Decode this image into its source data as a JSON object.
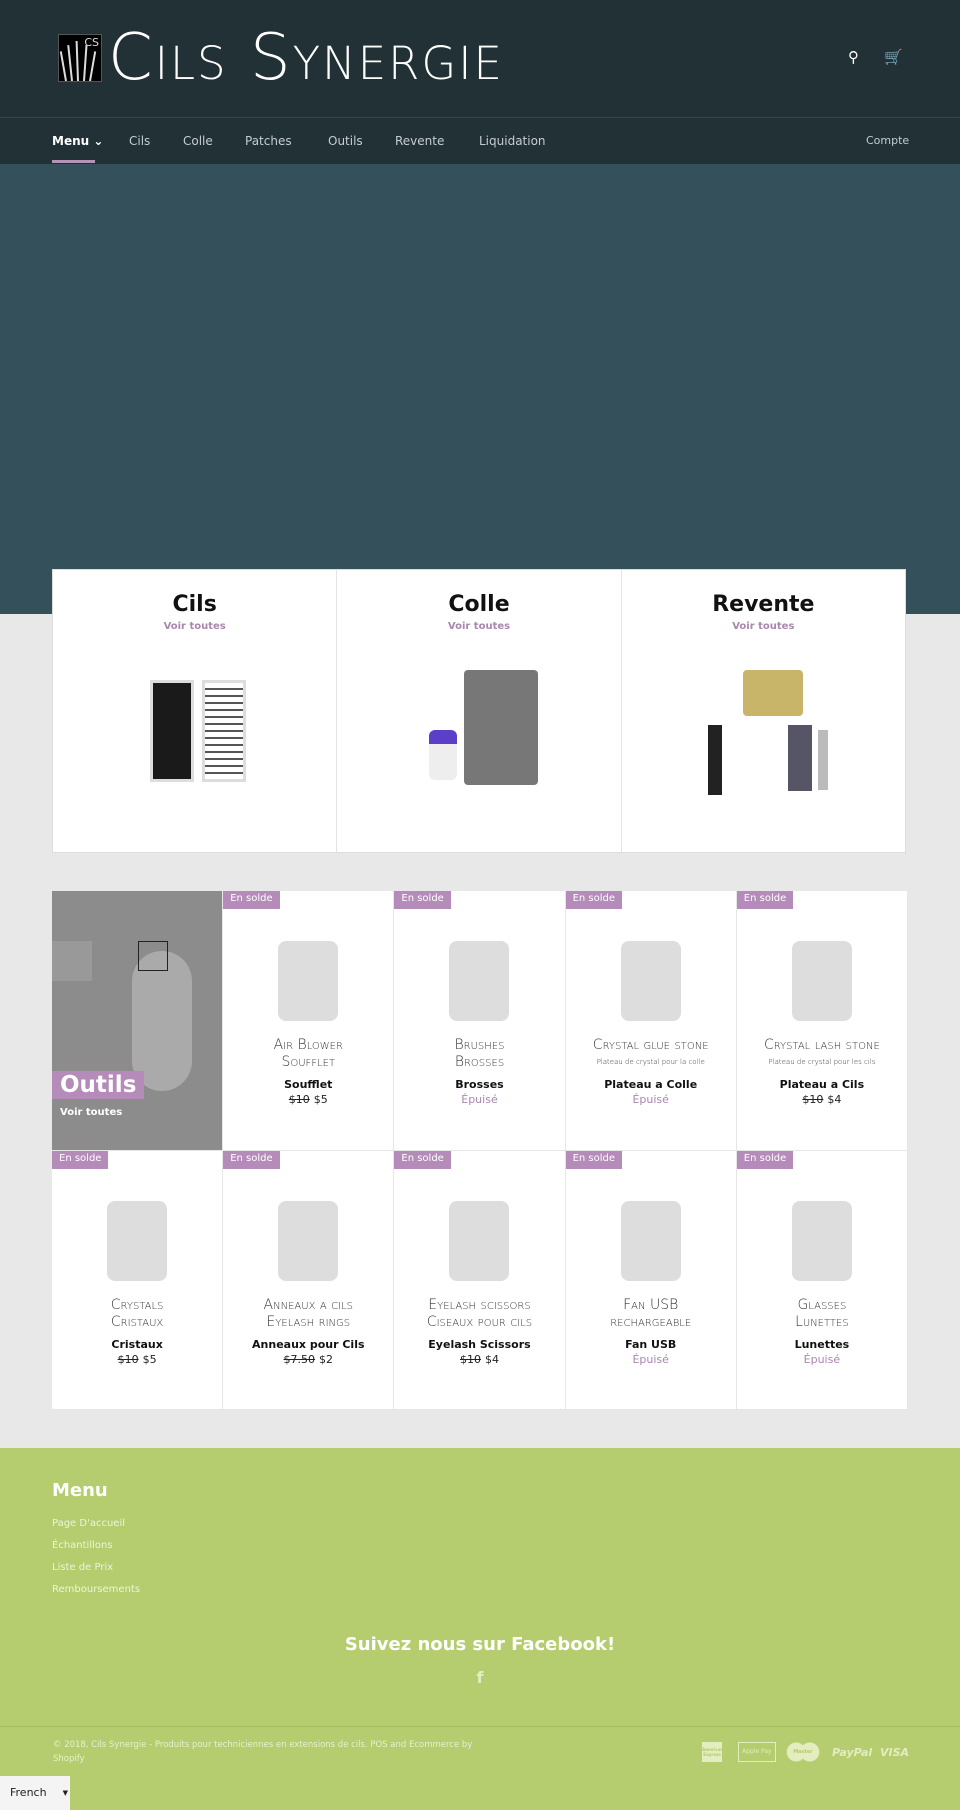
{
  "header": {
    "brand": "Cils Synergie",
    "logo_text": "CS",
    "icons": [
      "search-icon",
      "cart-icon"
    ]
  },
  "nav": {
    "items": [
      {
        "label": "Menu ⌄"
      },
      {
        "label": "Cils"
      },
      {
        "label": "Colle"
      },
      {
        "label": "Patches"
      },
      {
        "label": "Outils"
      },
      {
        "label": "Revente"
      },
      {
        "label": "Liquidation"
      }
    ],
    "account": "Compte"
  },
  "collections": [
    {
      "title": "Cils",
      "link": "Voir toutes"
    },
    {
      "title": "Colle",
      "link": "Voir toutes"
    },
    {
      "title": "Revente",
      "link": "Voir toutes"
    }
  ],
  "outils": {
    "title": "Outils",
    "link": "Voir toutes"
  },
  "badge": "En solde",
  "products": [
    {
      "name": "Soufflet",
      "old": "$10",
      "price": "$5",
      "img1": "Air Blower",
      "img2": "Soufflet",
      "img3": ""
    },
    {
      "name": "Brosses",
      "sold": "Épuisé",
      "img1": "Brushes",
      "img2": "Brosses",
      "img3": ""
    },
    {
      "name": "Plateau a Colle",
      "sold": "Épuisé",
      "img1": "Crystal glue stone",
      "img2": "",
      "img3": "Plateau de crystal pour la colle"
    },
    {
      "name": "Plateau a Cils",
      "old": "$10",
      "price": "$4",
      "img1": "Crystal lash stone",
      "img2": "",
      "img3": "Plateau de crystal pour les cils"
    },
    {
      "name": "Cristaux",
      "old": "$10",
      "price": "$5",
      "img1": "Crystals",
      "img2": "Cristaux",
      "img3": ""
    },
    {
      "name": "Anneaux pour Cils",
      "old": "$7.50",
      "price": "$2",
      "img1": "Anneaux a cils",
      "img2": "Eyelash rings",
      "img3": ""
    },
    {
      "name": "Eyelash Scissors",
      "old": "$10",
      "price": "$4",
      "img1": "Eyelash scissors",
      "img2": "Ciseaux pour cils",
      "img3": ""
    },
    {
      "name": "Fan USB",
      "sold": "Épuisé",
      "img1": "Fan USB",
      "img2": "rechargeable",
      "img3": ""
    },
    {
      "name": "Lunettes",
      "sold": "Épuisé",
      "img1": "Glasses",
      "img2": "Lunettes",
      "img3": ""
    }
  ],
  "footer": {
    "menu_title": "Menu",
    "links": [
      "Page D'accueil",
      "Échantillons",
      "Liste de Prix",
      "Remboursements"
    ],
    "facebook_title": "Suivez nous sur Facebook!",
    "facebook_icon": "f",
    "copyright": "© 2018, Cils Synergie - Produits pour techniciennes en extensions de cils. POS and Ecommerce by Shopify",
    "payments": [
      "American Express",
      "Apple Pay",
      "Master",
      "PayPal",
      "VISA"
    ]
  },
  "language": {
    "selected": "French"
  },
  "colors": {
    "header": "#213136",
    "hero": "#34505a",
    "accent": "#b58bb9",
    "footer": "#b5cc6f"
  }
}
